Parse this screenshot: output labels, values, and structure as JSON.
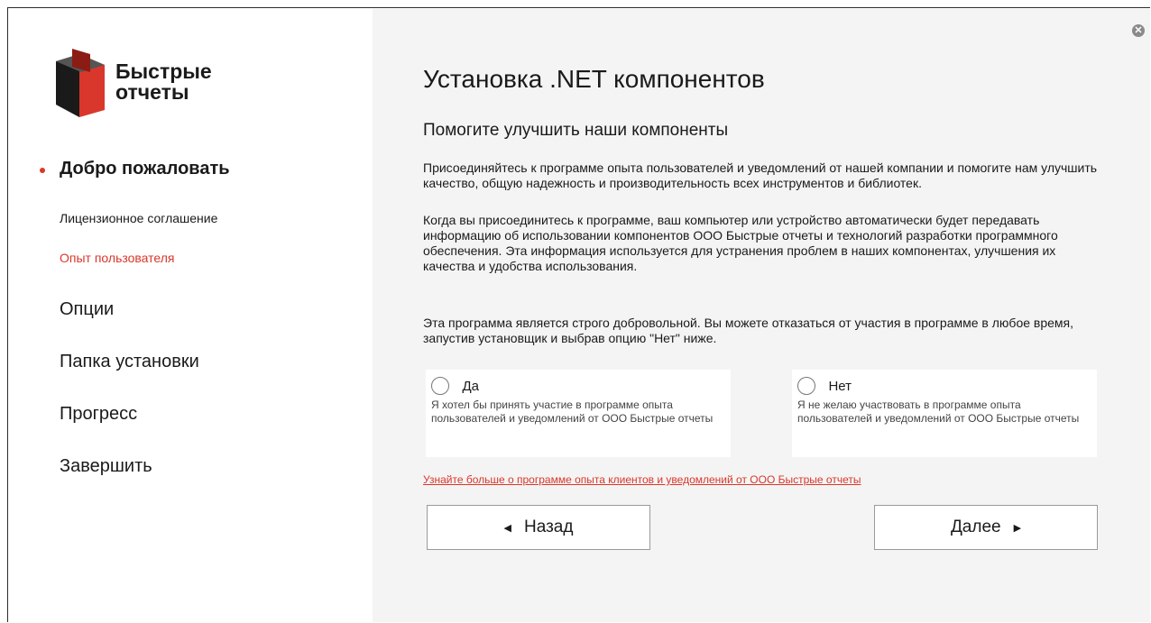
{
  "brand": {
    "line1": "Быстрые",
    "line2": "отчеты",
    "colors": {
      "red": "#d9372b",
      "dark": "#1a1a1a",
      "gray": "#6b6b6b"
    }
  },
  "sidebar": {
    "items": [
      {
        "label": "Добро пожаловать",
        "state": "active"
      },
      {
        "label": "Лицензионное соглашение",
        "state": "sub"
      },
      {
        "label": "Опыт пользователя",
        "state": "current-sub"
      },
      {
        "label": "Опции",
        "state": "normal"
      },
      {
        "label": "Папка установки",
        "state": "normal"
      },
      {
        "label": "Прогресс",
        "state": "normal"
      },
      {
        "label": "Завершить",
        "state": "normal"
      }
    ]
  },
  "main": {
    "title": "Установка .NET компонентов",
    "subtitle": "Помогите улучшить наши компоненты",
    "paragraphs": [
      "Присоединяйтесь к программе опыта пользователей и уведомлений от нашей компании и помогите нам улучшить качество, общую надежность и производительность всех инструментов и библиотек.",
      "Когда вы присоединитесь к программе, ваш компьютер или устройство автоматически будет передавать информацию об использовании компонентов ООО Быстрые отчеты и технологий разработки программного обеспечения. Эта информация используется для устранения проблем в наших компонентах, улучшения их качества и удобства использования.",
      "Эта программа является строго добровольной. Вы можете отказаться от участия в программе в любое время, запустив установщик и выбрав опцию \"Нет\" ниже."
    ],
    "options": [
      {
        "label": "Да",
        "description": "Я хотел бы принять участие в программе опыта пользователей и уведомлений от ООО Быстрые отчеты",
        "selected": false
      },
      {
        "label": "Нет",
        "description": "Я не желаю участвовать в программе опыта пользователей и уведомлений от ООО Быстрые отчеты",
        "selected": false
      }
    ],
    "link": "Узнайте больше о программе опыта клиентов и уведомлений от ООО Быстрые отчеты",
    "buttons": {
      "back": "Назад",
      "next": "Далее"
    }
  },
  "icons": {
    "back": "triangle-left-icon",
    "next": "triangle-right-icon",
    "close": "close-icon",
    "radio": "radio-unchecked-icon"
  }
}
